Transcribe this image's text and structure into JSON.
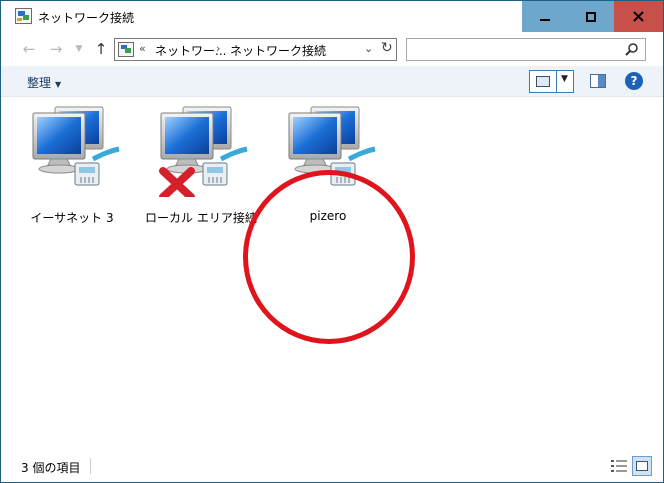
{
  "window": {
    "title": "ネットワーク接続",
    "controls": {
      "minimize_icon": "minimize-icon",
      "maximize_icon": "maximize-icon",
      "close_icon": "close-icon"
    }
  },
  "nav": {
    "back_icon": "back-arrow-icon",
    "forward_icon": "forward-arrow-icon",
    "recent_icon": "recent-locations-chevron-icon",
    "up_icon": "up-arrow-icon",
    "address": {
      "overflow": "«",
      "crumbs": [
        "ネットワー...",
        "ネットワーク接続"
      ],
      "separator": "›"
    },
    "search_placeholder": "",
    "search_icon": "magnifier-icon"
  },
  "command_bar": {
    "organize_label": "整理",
    "view_icon": "large-icons-view-icon",
    "preview_icon": "preview-pane-icon",
    "help_label": "?"
  },
  "items": [
    {
      "label": "イーサネット 3",
      "icon": "network-adapter-icon",
      "disabled": false
    },
    {
      "label": "ローカル エリア接続",
      "icon": "network-adapter-disconnected-icon",
      "disabled": true
    },
    {
      "label": "pizero",
      "icon": "network-adapter-icon",
      "disabled": false
    }
  ],
  "annotation": {
    "color": "#e0141c"
  },
  "status": {
    "item_count": "3 個の項目",
    "details_view_icon": "details-view-icon",
    "large_view_icon": "large-icons-view-icon"
  },
  "colors": {
    "accent": "#1f5f86",
    "window_button": "#6fa6cc",
    "close_button": "#c7504b",
    "command_bar": "#eef3fa"
  }
}
